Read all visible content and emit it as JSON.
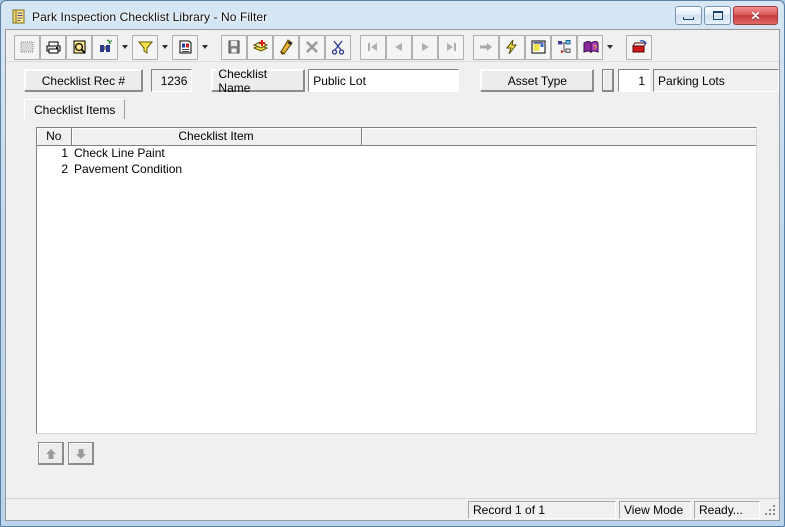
{
  "window": {
    "title": "Park Inspection Checklist Library - No Filter",
    "icon": "checklist-app-icon",
    "controls": {
      "minimize": "minimize-button",
      "maximize": "maximize-button",
      "close_glyph": "✕"
    },
    "colors": {
      "frame": "#b9d4ec",
      "client": "#f0f0f0",
      "close_button": "#c83c3c",
      "grid_header": "#f0f0f0"
    }
  },
  "toolbar": {
    "groups": [
      {
        "buttons": [
          {
            "name": "grid-view-icon",
            "tip": "Grid View",
            "framed": true,
            "dropdown": false
          },
          {
            "name": "print-icon",
            "tip": "Print",
            "framed": true,
            "dropdown": false
          },
          {
            "name": "print-preview-icon",
            "tip": "Print Preview",
            "framed": true,
            "dropdown": false
          },
          {
            "name": "find-binoculars-icon",
            "tip": "Find",
            "framed": true,
            "dropdown": true
          },
          {
            "name": "filter-funnel-icon",
            "tip": "Filter",
            "framed": true,
            "dropdown": true
          },
          {
            "name": "report-document-icon",
            "tip": "Report",
            "framed": true,
            "dropdown": true
          }
        ]
      },
      {
        "buttons": [
          {
            "name": "save-disk-icon",
            "tip": "Save",
            "framed": true,
            "dropdown": false
          },
          {
            "name": "add-record-icon",
            "tip": "Add Record",
            "framed": true,
            "dropdown": false
          },
          {
            "name": "edit-pencil-icon",
            "tip": "Edit",
            "framed": true,
            "dropdown": false
          },
          {
            "name": "delete-x-icon",
            "tip": "Delete",
            "framed": true,
            "dropdown": false
          },
          {
            "name": "cut-scissors-icon",
            "tip": "Cut",
            "framed": true,
            "dropdown": false
          }
        ]
      },
      {
        "buttons": [
          {
            "name": "first-record-icon",
            "tip": "First Record",
            "framed": true,
            "dropdown": false
          },
          {
            "name": "previous-record-icon",
            "tip": "Previous Record",
            "framed": true,
            "dropdown": false
          },
          {
            "name": "next-record-icon",
            "tip": "Next Record",
            "framed": true,
            "dropdown": false
          },
          {
            "name": "last-record-icon",
            "tip": "Last Record",
            "framed": true,
            "dropdown": false
          }
        ]
      },
      {
        "buttons": [
          {
            "name": "goto-arrow-icon",
            "tip": "Go To",
            "framed": true,
            "dropdown": false
          },
          {
            "name": "lightning-bolt-icon",
            "tip": "Quick Action",
            "framed": true,
            "dropdown": false
          },
          {
            "name": "form-window-icon",
            "tip": "Form View",
            "framed": true,
            "dropdown": false
          },
          {
            "name": "tree-hierarchy-icon",
            "tip": "Hierarchy",
            "framed": true,
            "dropdown": false
          },
          {
            "name": "help-book-icon",
            "tip": "Help",
            "framed": true,
            "dropdown": true
          }
        ]
      },
      {
        "buttons": [
          {
            "name": "exit-icon",
            "tip": "Exit",
            "framed": true,
            "dropdown": false
          }
        ]
      }
    ]
  },
  "fields": {
    "rec_label": "Checklist Rec #",
    "rec_value": "1236",
    "name_label": "Checklist Name",
    "name_value": "Public Lot",
    "asset_label": "Asset Type",
    "asset_code": "1",
    "asset_value": "Parking Lots"
  },
  "tabs": [
    {
      "label": "Checklist Items",
      "active": true
    }
  ],
  "grid": {
    "columns": [
      "No",
      "Checklist Item",
      ""
    ],
    "rows": [
      {
        "no": "1",
        "item": "Check Line Paint",
        "extra": ""
      },
      {
        "no": "2",
        "item": "Pavement Condition",
        "extra": ""
      }
    ]
  },
  "move_buttons": [
    {
      "name": "move-up-button",
      "glyph": "up-arrow-icon"
    },
    {
      "name": "move-down-button",
      "glyph": "down-arrow-icon"
    }
  ],
  "statusbar": {
    "record": "Record 1 of 1",
    "mode": "View Mode",
    "state": "Ready..."
  }
}
